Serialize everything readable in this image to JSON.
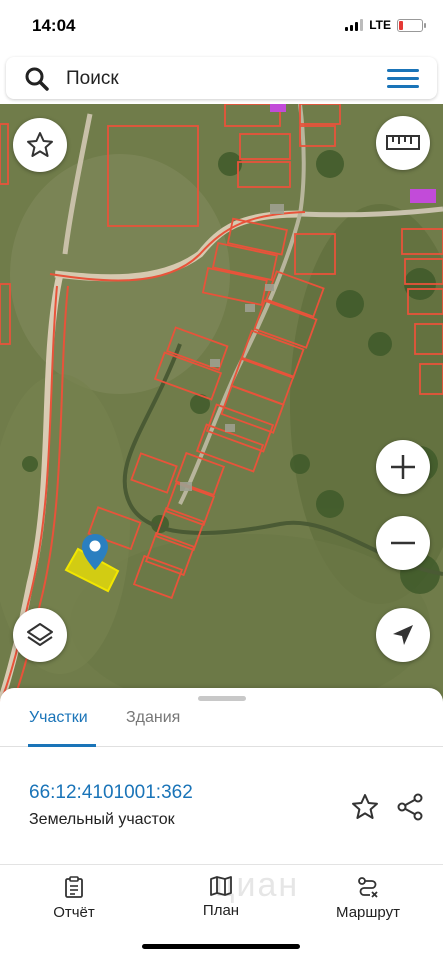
{
  "status": {
    "time": "14:04",
    "network": "LTE"
  },
  "search": {
    "placeholder": "Поиск",
    "value": ""
  },
  "tabs": [
    {
      "label": "Участки",
      "active": true
    },
    {
      "label": "Здания",
      "active": false
    }
  ],
  "parcel": {
    "number": "66:12:4101001:362",
    "type": "Земельный участок"
  },
  "watermark": "циан",
  "bottom_nav": [
    {
      "label": "Отчёт",
      "icon": "report-icon"
    },
    {
      "label": "План",
      "icon": "map-plan-icon"
    },
    {
      "label": "Маршрут",
      "icon": "route-icon"
    }
  ],
  "map_controls": [
    "favorite-star-icon",
    "ruler-icon",
    "zoom-in-icon",
    "zoom-out-icon",
    "layers-icon",
    "locate-icon"
  ],
  "colors": {
    "accent": "#1a74b8",
    "parcel_outline": "#e8533a",
    "selected_parcel": "#f2e600",
    "battery_low": "#e53935"
  }
}
